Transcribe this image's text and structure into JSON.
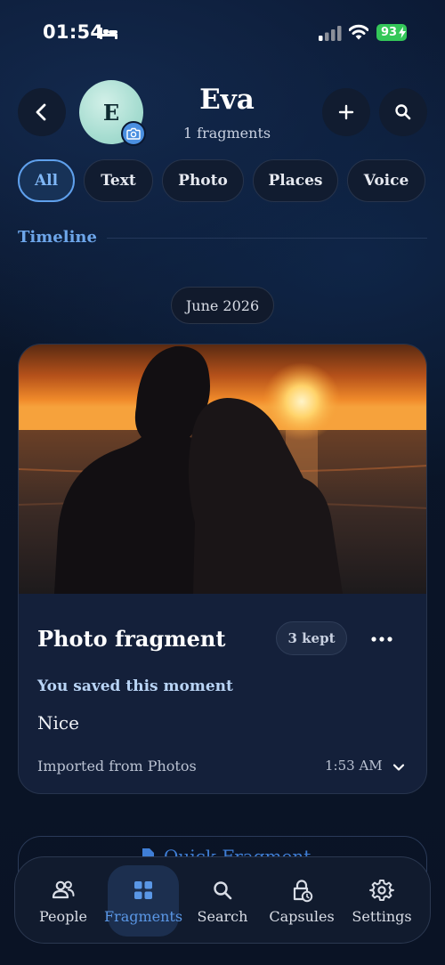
{
  "status_bar": {
    "time": "01:54",
    "battery_level": "93",
    "battery_color": "#34c759",
    "icons": [
      "bed-icon",
      "cellular-signal-icon",
      "wifi-icon",
      "battery-charging-icon"
    ]
  },
  "header": {
    "back_icon": "chevron-left-icon",
    "avatar_initial": "E",
    "avatar_badge_icon": "camera-icon",
    "contact_name": "Eva",
    "fragment_count": "1 fragments",
    "add_icon": "plus-icon",
    "search_icon": "search-icon"
  },
  "filters": [
    {
      "label": "All",
      "active": true
    },
    {
      "label": "Text",
      "active": false
    },
    {
      "label": "Photo",
      "active": false
    },
    {
      "label": "Places",
      "active": false
    },
    {
      "label": "Voice",
      "active": false
    }
  ],
  "timeline": {
    "section_label": "Timeline",
    "month": "June 2026"
  },
  "fragment_card": {
    "photo_description_icon": "sunset-photo",
    "title": "Photo fragment",
    "kept_badge": "3 kept",
    "more_icon": "more-horizontal-icon",
    "saved_label": "You saved this moment",
    "note": "Nice",
    "source": "Imported from Photos",
    "time": "1:53 AM",
    "expand_icon": "chevron-down-icon"
  },
  "quick_fragment": {
    "icon": "document-icon",
    "label": "Quick Fragment"
  },
  "tab_bar": {
    "accent_color": "#5a97e6",
    "tabs": [
      {
        "label": "People",
        "icon": "people-icon",
        "active": false
      },
      {
        "label": "Fragments",
        "icon": "grid-icon",
        "active": true
      },
      {
        "label": "Search",
        "icon": "search-icon",
        "active": false
      },
      {
        "label": "Capsules",
        "icon": "lock-clock-icon",
        "active": false
      },
      {
        "label": "Settings",
        "icon": "gear-icon",
        "active": false
      }
    ]
  }
}
